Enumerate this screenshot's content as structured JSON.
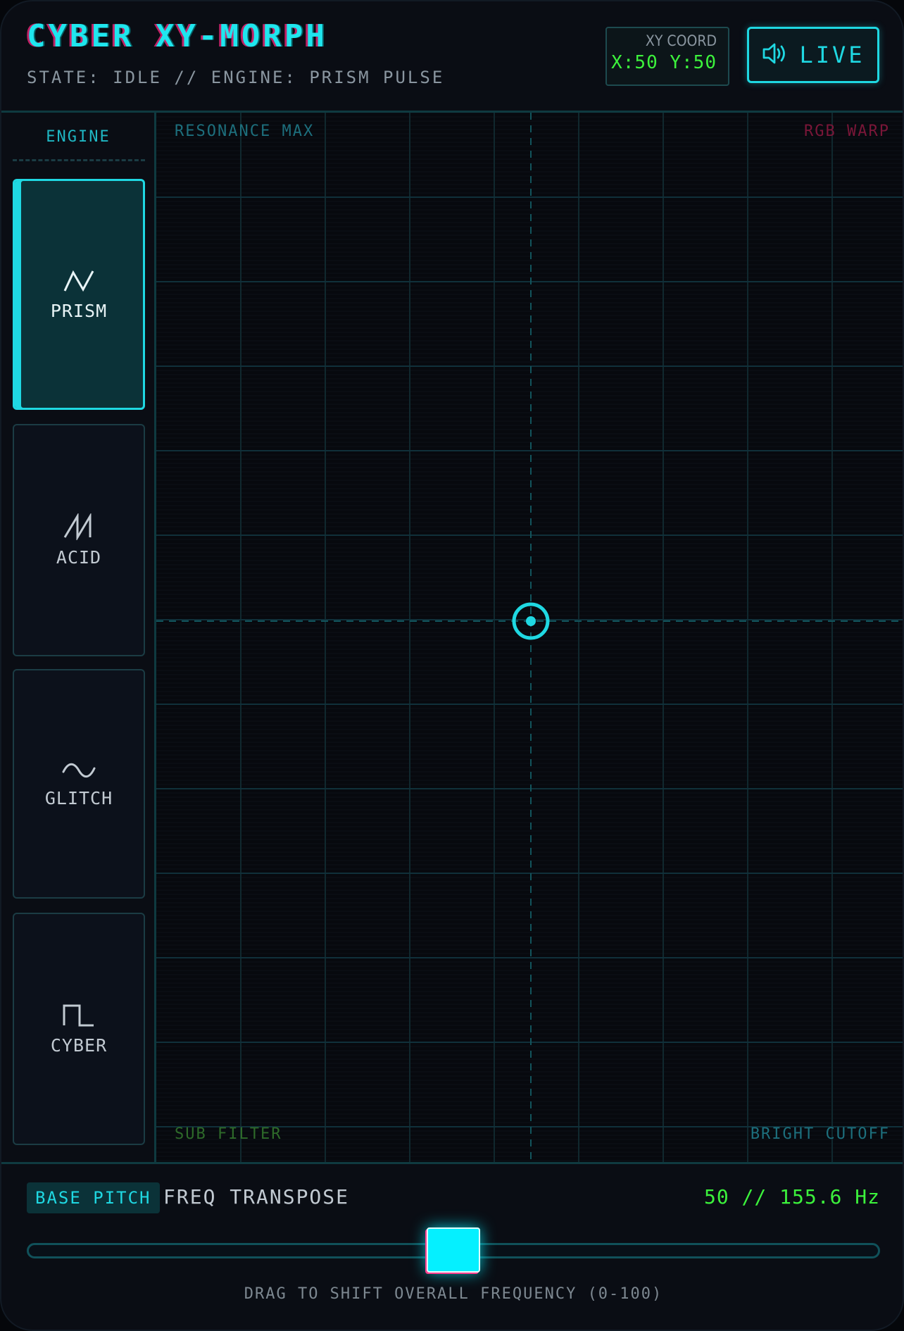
{
  "header": {
    "title": "CYBER XY-MORPH",
    "status": "STATE: IDLE // ENGINE: PRISM PULSE",
    "xy_label": "XY COORD",
    "xy_value": "X:50 Y:50",
    "live_label": "LIVE",
    "live_icon": "speaker-icon"
  },
  "sidebar": {
    "title": "ENGINE",
    "engines": [
      {
        "label": "PRISM",
        "icon": "triangle-wave-icon",
        "active": true
      },
      {
        "label": "ACID",
        "icon": "sawtooth-wave-icon",
        "active": false
      },
      {
        "label": "GLITCH",
        "icon": "sine-wave-icon",
        "active": false
      },
      {
        "label": "CYBER",
        "icon": "square-wave-icon",
        "active": false
      }
    ]
  },
  "pad": {
    "top_left": "RESONANCE MAX",
    "top_right": "RGB WARP",
    "bottom_left": "SUB FILTER",
    "bottom_right": "BRIGHT CUTOFF",
    "x": 50,
    "y": 50
  },
  "pitch": {
    "badge": "BASE PITCH",
    "label": "FREQ TRANSPOSE",
    "value_text": "50 // 155.6 Hz",
    "value": 50,
    "hint": "DRAG TO SHIFT OVERALL FREQUENCY (0-100)"
  },
  "colors": {
    "accent": "#1fd8e2",
    "readout_green": "#3cf23c",
    "rgb_warp": "#7a1638",
    "sub_filter": "#2e6a2a",
    "bright_cutoff": "#1d6f7d",
    "resonance": "#1d6f7d",
    "glitch_pink": "#ff3f8f"
  }
}
